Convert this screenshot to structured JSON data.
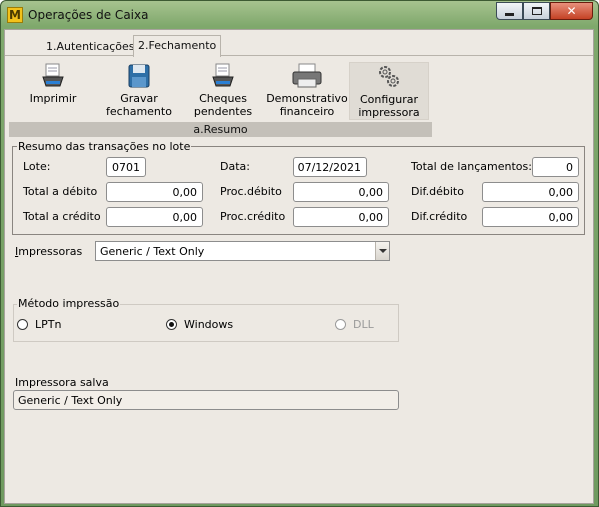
{
  "window": {
    "title": "Operações de Caixa",
    "app_icon_letter": "M"
  },
  "tabs": [
    {
      "label": "1.Autenticações",
      "active": false
    },
    {
      "label": "2.Fechamento",
      "active": true
    }
  ],
  "toolbar": {
    "buttons": [
      {
        "line1": "Imprimir",
        "line2": "",
        "icon": "printer-doc-icon"
      },
      {
        "line1": "Gravar",
        "line2": "fechamento",
        "icon": "save-disk-icon"
      },
      {
        "line1": "Cheques",
        "line2": "pendentes",
        "icon": "printer-doc-icon"
      },
      {
        "line1": "Demonstrativo",
        "line2": "financeiro",
        "icon": "printer-icon"
      },
      {
        "line1": "Configurar",
        "line2": "impressora",
        "icon": "gears-icon"
      }
    ],
    "group_label": "a.Resumo"
  },
  "summary": {
    "legend": "Resumo das transações no lote",
    "lote_label": "Lote:",
    "lote_value": "0701",
    "data_label": "Data:",
    "data_value": "07/12/2021",
    "total_lanc_label": "Total de lançamentos:",
    "total_lanc_value": "0",
    "total_debito_label": "Total a débito",
    "total_debito_value": "0,00",
    "proc_debito_label": "Proc.débito",
    "proc_debito_value": "0,00",
    "dif_debito_label": "Dif.débito",
    "dif_debito_value": "0,00",
    "total_credito_label": "Total a crédito",
    "total_credito_value": "0,00",
    "proc_credito_label": "Proc.crédito",
    "proc_credito_value": "0,00",
    "dif_credito_label": "Dif.crédito",
    "dif_credito_value": "0,00"
  },
  "printers": {
    "label_first": "I",
    "label_rest": "mpressoras",
    "selected": "Generic / Text Only"
  },
  "print_method": {
    "legend": "Método impressão",
    "options": [
      {
        "label": "LPTn",
        "selected": false,
        "enabled": true
      },
      {
        "label": "Windows",
        "selected": true,
        "enabled": true
      },
      {
        "label": "DLL",
        "selected": false,
        "enabled": false
      }
    ]
  },
  "saved_printer": {
    "label": "Impressora salva",
    "value": "Generic / Text Only"
  },
  "colors": {
    "titlebar": "#7fa86c",
    "client": "#ede9e3",
    "close_button": "#c44225",
    "toolbar_group": "#c4c0b9"
  }
}
